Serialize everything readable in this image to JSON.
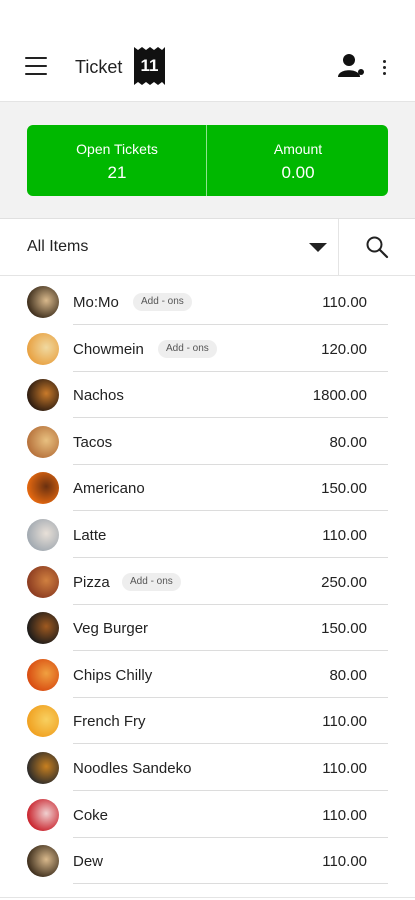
{
  "header": {
    "title": "Ticket",
    "ticket_number": "11",
    "icons": [
      "menu-icon",
      "ticket-icon",
      "profile-icon",
      "more-vertical-icon"
    ]
  },
  "summary": {
    "open_tickets_label": "Open Tickets",
    "open_tickets_value": "21",
    "amount_label": "Amount",
    "amount_value": "0.00",
    "accent_color": "#00b800"
  },
  "filter": {
    "selected_category": "All Items",
    "icons": [
      "dropdown-caret-icon",
      "search-icon"
    ]
  },
  "items": [
    {
      "name": "Mo:Mo",
      "addon": "Add - ons",
      "price": "110.00",
      "thumb_colors": [
        "#3a2b1a",
        "#d9b98c"
      ]
    },
    {
      "name": "Chowmein",
      "addon": "Add - ons",
      "price": "120.00",
      "thumb_colors": [
        "#e8a040",
        "#f0d9a0"
      ]
    },
    {
      "name": "Nachos",
      "addon": "",
      "price": "1800.00",
      "thumb_colors": [
        "#2a1a10",
        "#c97a2a"
      ]
    },
    {
      "name": "Tacos",
      "addon": "",
      "price": "80.00",
      "thumb_colors": [
        "#b5703a",
        "#e8c080"
      ]
    },
    {
      "name": "Americano",
      "addon": "",
      "price": "150.00",
      "thumb_colors": [
        "#e86a10",
        "#6a3010"
      ]
    },
    {
      "name": "Latte",
      "addon": "",
      "price": "110.00",
      "thumb_colors": [
        "#a0a8b0",
        "#e8e0d8"
      ]
    },
    {
      "name": "Pizza",
      "addon": "Add - ons",
      "price": "250.00",
      "thumb_colors": [
        "#8a3a20",
        "#d08040"
      ]
    },
    {
      "name": "Veg Burger",
      "addon": "",
      "price": "150.00",
      "thumb_colors": [
        "#1a1a1a",
        "#a05a20"
      ]
    },
    {
      "name": "Chips Chilly",
      "addon": "",
      "price": "80.00",
      "thumb_colors": [
        "#d84a10",
        "#f0a040"
      ]
    },
    {
      "name": "French Fry",
      "addon": "",
      "price": "110.00",
      "thumb_colors": [
        "#f0a020",
        "#f8d060"
      ]
    },
    {
      "name": "Noodles Sandeko",
      "addon": "",
      "price": "110.00",
      "thumb_colors": [
        "#2a2a2a",
        "#c88020"
      ]
    },
    {
      "name": "Coke",
      "addon": "",
      "price": "110.00",
      "thumb_colors": [
        "#c8202a",
        "#f0d0d0"
      ]
    },
    {
      "name": "Dew",
      "addon": "",
      "price": "110.00",
      "thumb_colors": [
        "#3a2b1a",
        "#d9b98c"
      ]
    }
  ]
}
